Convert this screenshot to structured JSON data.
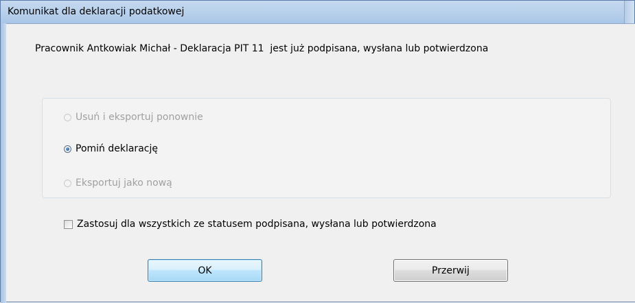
{
  "window": {
    "title": "Komunikat dla deklaracji podatkowej"
  },
  "message": "Pracownik Antkowiak Michał - Deklaracja PIT 11  jest już podpisana, wysłana lub potwierdzona",
  "options": [
    {
      "label": "Usuń i eksportuj ponownie",
      "selected": false,
      "enabled": false
    },
    {
      "label": "Pomiń deklarację",
      "selected": true,
      "enabled": true
    },
    {
      "label": "Eksportuj jako nową",
      "selected": false,
      "enabled": false
    }
  ],
  "apply_all": {
    "label": "Zastosuj dla wszystkich ze statusem podpisana, wysłana lub potwierdzona",
    "checked": false
  },
  "buttons": {
    "ok": "OK",
    "cancel": "Przerwij"
  },
  "colors": {
    "titlebar": "#b9d1ec",
    "dialog_bg": "#f0f0f0",
    "disabled_text": "#a0a0a0",
    "ok_button_border": "#3c7fb1"
  }
}
